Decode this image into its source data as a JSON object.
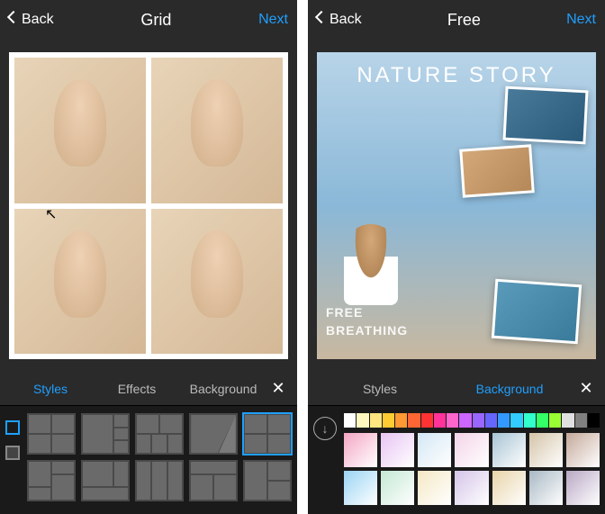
{
  "left": {
    "back": "Back",
    "title": "Grid",
    "next": "Next",
    "tabs": {
      "styles": "Styles",
      "effects": "Effects",
      "background": "Background"
    },
    "activeTab": "styles"
  },
  "right": {
    "back": "Back",
    "title": "Free",
    "next": "Next",
    "overlay": {
      "title": "NATURE STORY",
      "line1": "FREE",
      "line2": "BREATHING"
    },
    "tabs": {
      "styles": "Styles",
      "background": "Background"
    },
    "activeTab": "background",
    "swatches": [
      "#ffffff",
      "#fff7c0",
      "#ffe680",
      "#ffcc33",
      "#ff9933",
      "#ff6633",
      "#ff3333",
      "#ff3399",
      "#ff66cc",
      "#cc66ff",
      "#9966ff",
      "#6666ff",
      "#3399ff",
      "#33ccff",
      "#33ffcc",
      "#33ff66",
      "#99ff33",
      "#e0e0e0",
      "#808080",
      "#000000"
    ],
    "bgThumbs": [
      "#f4a6c4",
      "#e8c4f4",
      "#d4e8f4",
      "#f4d4e8",
      "#a8c4d4",
      "#d4c4a8",
      "#c4a89a",
      "#9ad4f4",
      "#c4e8d4",
      "#f4e8c4",
      "#d4c4e8",
      "#e8d4a8",
      "#a8b8c4",
      "#b8a8c4"
    ]
  }
}
